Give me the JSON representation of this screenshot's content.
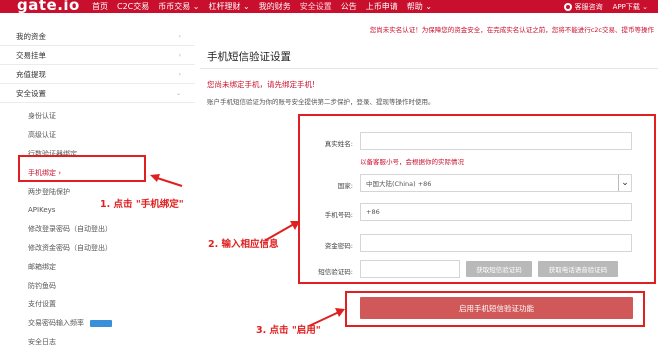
{
  "header": {
    "logo": "gate.io",
    "nav": [
      "首页",
      "C2C交易",
      "币币交易 ⌄",
      "杠杆理财 ⌄",
      "我的财务",
      "安全设置",
      "公告",
      "上币申请",
      "帮助 ⌄"
    ],
    "support": "客服咨询",
    "app_download": "APP下载 ⌄"
  },
  "sidebar": {
    "sections": [
      {
        "label": "我的资金",
        "chevron": "›"
      },
      {
        "label": "交易挂单",
        "chevron": "›"
      },
      {
        "label": "充值提现",
        "chevron": "›"
      },
      {
        "label": "安全设置",
        "chevron": "⌄"
      }
    ],
    "items": [
      "身份认证",
      "高级认证",
      "行数验证器绑定",
      "手机绑定 ›",
      "两步登陆保护",
      "APIKeys",
      "修改登录密码（自动登出）",
      "修改资金密码（自动登出）",
      "邮箱绑定",
      "防钓鱼码",
      "支付设置",
      "交易密码输入频率",
      "安全日志"
    ]
  },
  "notice": "您尚未实名认证！为保障您的资金安全，在完成实名认证之前，您将不能进行c2c交易、提币等操作",
  "main": {
    "title": "手机短信验证设置",
    "warn": "您尚未绑定手机，请先绑定手机!",
    "desc": "账户手机短信验证为你的账号安全提供第二步保护，登录、提现等操作时使用。",
    "form": {
      "name_label": "真实姓名:",
      "name_hint": "以备客服小号，会根据你的实际情况",
      "country_label": "国家:",
      "country_value": "中国大陆(China) +86",
      "phone_label": "手机号码:",
      "phone_prefix": "+86",
      "fundpw_label": "资金密码:",
      "code_label": "短信验证码:",
      "btn_sms": "获取短信验证码",
      "btn_voice": "获取电话语音验证码"
    },
    "submit": "启用手机短信验证功能"
  },
  "annotations": {
    "step1": "1. 点击 \"手机绑定\"",
    "step2": "2. 输入相应信息",
    "step3": "3. 点击 \"启用\""
  },
  "colors": {
    "brand_red": "#c8102e",
    "annotation_red": "#e02020",
    "submit_bg": "#d05858",
    "disabled_btn": "#b9b9b9"
  }
}
